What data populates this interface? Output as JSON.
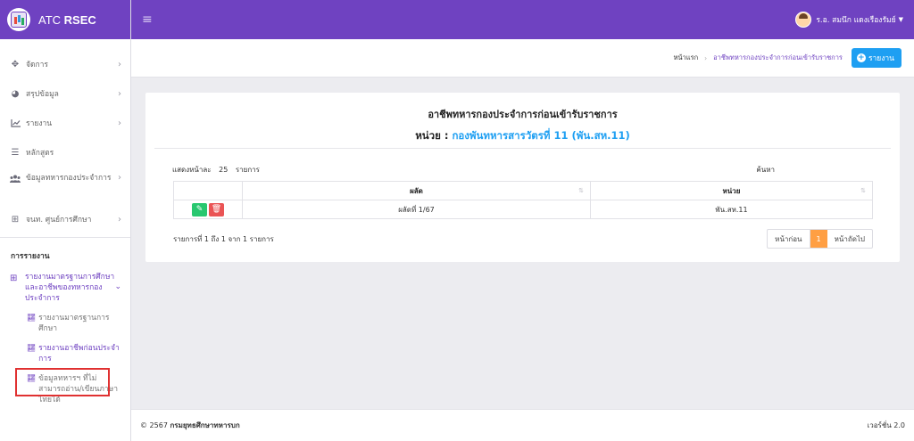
{
  "brand": {
    "prefix": "ATC ",
    "bold": "RSEC"
  },
  "user": {
    "name": "ร.อ. สมนึก แดงเรืองรัมย์"
  },
  "sidebar": {
    "items": [
      {
        "label": "จัดการ",
        "icon": "arrows-move-icon"
      },
      {
        "label": "สรุปข้อมูล",
        "icon": "pie-chart-icon"
      },
      {
        "label": "รายงาน",
        "icon": "line-chart-icon"
      },
      {
        "label": "หลักสูตร",
        "icon": "list-icon"
      },
      {
        "label": "ข้อมูลทหารกองประจำการ",
        "icon": "users-icon"
      },
      {
        "label": "จนท. ศูนย์การศึกษา",
        "icon": "grid-icon"
      }
    ],
    "section": "การรายงาน",
    "open_group": "รายงานมาตรฐานการศึกษาและอาชีพของทหารกองประจำการ",
    "sub_items": [
      "รายงานมาตรฐานการศึกษา",
      "รายงานอาชีพก่อนประจำการ",
      "ข้อมูลทหารฯ ที่ไม่สามารถอ่าน/เขียนภาษาไทยได้"
    ]
  },
  "breadcrumb": {
    "home": "หน้าแรก",
    "current": "อาชีพทหารกองประจำการก่อนเข้ารับราชการ"
  },
  "header_button": "รายงาน",
  "card": {
    "title": "อาชีพทหารกองประจำการก่อนเข้ารับราชการ",
    "unit_label": "หน่วย : ",
    "unit_value": "กองพันทหารสารวัตรที่ 11 (พัน.สห.11)"
  },
  "table_controls": {
    "show_prefix": "แสดงหน้าละ",
    "page_length": "25",
    "show_suffix": "รายการ",
    "search_label": "ค้นหา"
  },
  "table": {
    "columns": [
      "ผลัด",
      "หน่วย"
    ],
    "rows": [
      {
        "round": "ผลัดที่ 1/67",
        "unit": "พัน.สห.11"
      }
    ]
  },
  "footer_info": "รายการที่ 1 ถึง 1 จาก 1 รายการ",
  "pagination": {
    "prev": "หน้าก่อน",
    "current": "1",
    "next": "หน้าถัดไป"
  },
  "footer": {
    "copyright_prefix": "© 2567 ",
    "org": "กรมยุทธศึกษาทหารบก",
    "version": "เวอร์ชั่น 2.0"
  },
  "colors": {
    "primary": "#6f42c1",
    "info": "#1e9ff2",
    "edit": "#28c76f",
    "delete": "#ea5455",
    "page_active": "#ff9f43"
  }
}
